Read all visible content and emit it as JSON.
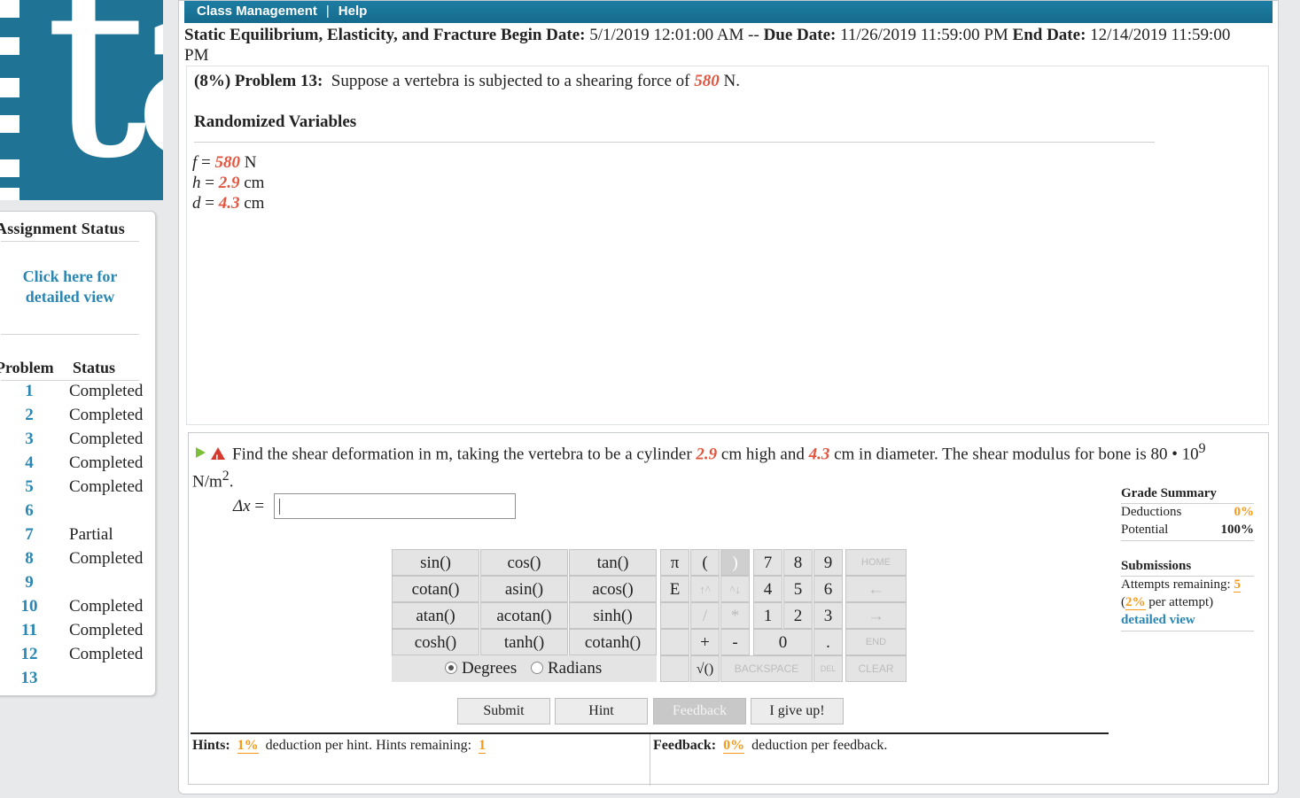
{
  "nav": {
    "class_management": "Class Management",
    "separator": "|",
    "help": "Help"
  },
  "assignment": {
    "title": "Static Equilibrium, Elasticity, and Fracture",
    "begin_label": "Begin Date:",
    "begin_value": "5/1/2019 12:01:00 AM --",
    "due_label": "Due Date:",
    "due_value": "11/26/2019 11:59:00 PM",
    "end_label": "End Date:",
    "end_value": "12/14/2019 11:59:00 PM"
  },
  "problem": {
    "weight": "(8%)",
    "label": "Problem 13:",
    "text_before": "Suppose a vertebra is subjected to a shearing force of",
    "force_value": "580",
    "text_after": "N.",
    "randomized_title": "Randomized Variables",
    "variables": [
      {
        "name": "f",
        "eq": " = ",
        "value": "580",
        "unit": " N"
      },
      {
        "name": "h",
        "eq": " = ",
        "value": "2.9",
        "unit": " cm"
      },
      {
        "name": "d",
        "eq": " = ",
        "value": "4.3",
        "unit": " cm"
      }
    ]
  },
  "part": {
    "text_1": "Find the shear deformation in m, taking the vertebra to be a cylinder",
    "h_value": "2.9",
    "text_2": "cm high and",
    "d_value": "4.3",
    "text_3": "cm in diameter. The shear modulus for bone is 80 •",
    "text_4": "10",
    "exp": "9",
    "text_5": " N/m",
    "exp2": "2",
    "text_6": ".",
    "answer_label": "Δx",
    "answer_eq": " = ",
    "answer_value": ""
  },
  "calculator": {
    "functions": [
      [
        "sin()",
        "cos()",
        "tan()"
      ],
      [
        "cotan()",
        "asin()",
        "acos()"
      ],
      [
        "atan()",
        "acotan()",
        "sinh()"
      ],
      [
        "cosh()",
        "tanh()",
        "cotanh()"
      ]
    ],
    "degrees": "Degrees",
    "radians": "Radians",
    "keys": {
      "pi": "π",
      "lparen": "(",
      "rparen": ")",
      "e": "E",
      "up": "↑^",
      "down": "^↓",
      "slash": "/",
      "star": "*",
      "plus": "+",
      "minus": "-",
      "sqrt": "√()",
      "n7": "7",
      "n8": "8",
      "n9": "9",
      "n4": "4",
      "n5": "5",
      "n6": "6",
      "n1": "1",
      "n2": "2",
      "n3": "3",
      "n0": "0",
      "dot": ".",
      "home": "HOME",
      "left": "←",
      "right": "→",
      "end": "END",
      "backspace": "BACKSPACE",
      "del": "DEL",
      "clear": "CLEAR"
    }
  },
  "actions": {
    "submit": "Submit",
    "hint": "Hint",
    "feedback": "Feedback",
    "give_up": "I give up!"
  },
  "grade_summary": {
    "title": "Grade Summary",
    "deductions_label": "Deductions",
    "deductions_value": "0%",
    "potential_label": "Potential",
    "potential_value": "100%",
    "submissions_title": "Submissions",
    "attempts_label": "Attempts remaining:",
    "attempts_value": "5",
    "per_attempt_open": "(",
    "per_attempt_value": "2%",
    "per_attempt_text": " per attempt)",
    "detailed_view": "detailed view"
  },
  "hints": {
    "label": "Hints:",
    "deduction": "1%",
    "text": "deduction per hint. Hints remaining:",
    "remaining": "1"
  },
  "feedback": {
    "label": "Feedback:",
    "deduction": "0%",
    "text": "deduction per feedback."
  },
  "sidebar": {
    "status_title": "Assignment Status",
    "detail_link": "Click here for detailed view",
    "col_problem": "Problem",
    "col_status": "Status",
    "problems": [
      {
        "num": "1",
        "status": "Completed"
      },
      {
        "num": "2",
        "status": "Completed"
      },
      {
        "num": "3",
        "status": "Completed"
      },
      {
        "num": "4",
        "status": "Completed"
      },
      {
        "num": "5",
        "status": "Completed"
      },
      {
        "num": "6",
        "status": ""
      },
      {
        "num": "7",
        "status": "Partial"
      },
      {
        "num": "8",
        "status": "Completed"
      },
      {
        "num": "9",
        "status": ""
      },
      {
        "num": "10",
        "status": "Completed"
      },
      {
        "num": "11",
        "status": "Completed"
      },
      {
        "num": "12",
        "status": "Completed"
      },
      {
        "num": "13",
        "status": ""
      }
    ]
  }
}
